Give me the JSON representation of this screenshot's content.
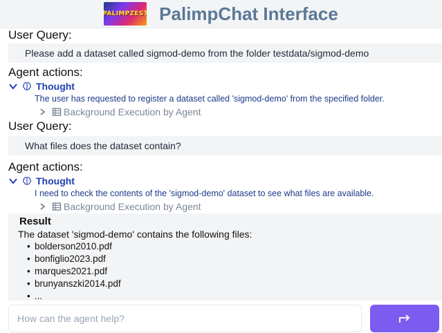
{
  "app": {
    "logo_text": "PALIMPZEST",
    "title": "PalimpChat Interface"
  },
  "conversation": {
    "turn1": {
      "user_query_label": "User Query:",
      "user_query": "Please add a dataset called sigmod-demo from the folder testdata/sigmod-demo",
      "agent_actions_label": "Agent actions:",
      "thought_label": "Thought",
      "thought_text": "The user has requested to register a dataset called 'sigmod-demo' from the specified folder.",
      "background_label": "Background Execution by Agent"
    },
    "turn2": {
      "user_query_label": "User Query:",
      "user_query": "What files does the dataset contain?",
      "agent_actions_label": "Agent actions:",
      "thought_label": "Thought",
      "thought_text": "I need to check the contents of the 'sigmod-demo' dataset to see what files are available.",
      "background_label": "Background Execution by Agent",
      "result_title": "Result",
      "result_text": "The dataset 'sigmod-demo' contains the following files:",
      "files": [
        "bolderson2010.pdf",
        "bonfiglio2023.pdf",
        "marques2021.pdf",
        "brunyanszki2014.pdf",
        "..."
      ]
    }
  },
  "input": {
    "placeholder": "How can the agent help?"
  },
  "icons": {
    "expanded": "chevron-down-icon",
    "collapsed": "chevron-right-icon",
    "thought": "brain-icon",
    "background": "table-icon",
    "send": "send-arrow-icon"
  },
  "colors": {
    "accent": "#7c5cf0",
    "title": "#5b7896",
    "thought": "#1e40af",
    "muted": "#7a8698"
  }
}
